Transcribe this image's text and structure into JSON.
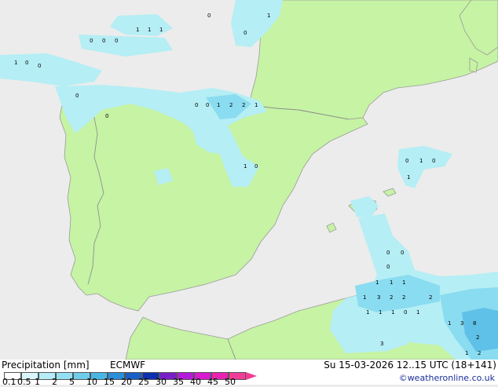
{
  "title": "Precipitation [mm]",
  "model": "ECMWF",
  "datetime": "Su 15-03-2026 12..15 UTC (18+141)",
  "credit": "©weatheronline.co.uk",
  "legend": {
    "labels": [
      "0.1",
      "0.5",
      "1",
      "2",
      "5",
      "10",
      "15",
      "20",
      "25",
      "30",
      "35",
      "40",
      "45",
      "50"
    ],
    "colors": [
      "#ffffff",
      "#d8f6fb",
      "#b6ecf7",
      "#94e0f3",
      "#6fcdeb",
      "#4bb6e3",
      "#2b8ed8",
      "#1a5fc4",
      "#0d2fb0",
      "#7a1fc8",
      "#b51ad8",
      "#d81ad0",
      "#ea22b2",
      "#f23d96"
    ]
  },
  "colors": {
    "sea": "#ececec",
    "land": "#c6f3a4",
    "rain_light": "#b5eef5",
    "rain_mid": "#8adcf0",
    "rain_heavy": "#5fc1e8",
    "border": "#888888",
    "coast": "#9a9a9a"
  },
  "map_values": [
    "1",
    "1",
    "1",
    "1",
    "0",
    "0",
    "0",
    "0",
    "0",
    "0",
    "1",
    "0",
    "0",
    "0",
    "0",
    "0",
    "1",
    "2",
    "2",
    "1",
    "1",
    "0",
    "0",
    "1",
    "0",
    "1",
    "0",
    "0",
    "0",
    "1",
    "1",
    "1",
    "1",
    "3",
    "2",
    "2",
    "2",
    "1",
    "1",
    "1",
    "0",
    "1",
    "1",
    "3",
    "8",
    "2",
    "3",
    "1",
    "2"
  ]
}
